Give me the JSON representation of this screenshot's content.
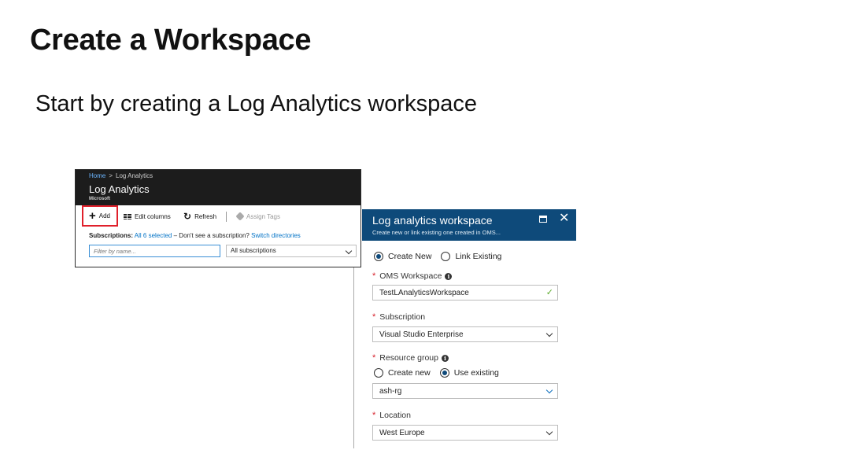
{
  "slide": {
    "title": "Create a Workspace",
    "subtitle": "Start by creating a Log Analytics workspace"
  },
  "log_analytics_blade": {
    "breadcrumb": {
      "home": "Home",
      "separator": ">",
      "current": "Log Analytics"
    },
    "title": "Log Analytics",
    "publisher": "Microsoft",
    "toolbar": {
      "add_label": "Add",
      "edit_columns_label": "Edit columns",
      "refresh_label": "Refresh",
      "assign_tags_label": "Assign Tags"
    },
    "subscriptions": {
      "label": "Subscriptions:",
      "selected_link": "All 6 selected",
      "prompt": "– Don't see a subscription?",
      "switch_link": "Switch directories"
    },
    "filter": {
      "placeholder": "Filter by name..."
    },
    "subscription_select": {
      "value": "All subscriptions"
    },
    "colors": {
      "header_bg": "#1c1c1c",
      "link": "#0072c6",
      "highlight": "#e0202b"
    },
    "icons": {
      "add": "plus-icon",
      "edit_columns": "grid-icon",
      "refresh": "refresh-icon",
      "assign_tags": "tag-icon"
    }
  },
  "workspace_blade": {
    "title": "Log analytics workspace",
    "subtitle": "Create new or link existing one created in OMS...",
    "header_color": "#0e4a7a",
    "mode": {
      "create_new_label": "Create New",
      "link_existing_label": "Link Existing",
      "selected": "Create New"
    },
    "oms_workspace": {
      "label": "OMS Workspace",
      "value": "TestLAnalyticsWorkspace",
      "valid": true
    },
    "subscription": {
      "label": "Subscription",
      "value": "Visual Studio Enterprise"
    },
    "resource_group": {
      "label": "Resource group",
      "create_new_label": "Create new",
      "use_existing_label": "Use existing",
      "selected": "Use existing",
      "value": "ash-rg"
    },
    "location": {
      "label": "Location",
      "value": "West Europe"
    },
    "required_marker": "*",
    "info_glyph": "i",
    "icons": {
      "maximize": "maximize-icon",
      "close": "close-icon",
      "info": "info-icon",
      "valid": "check-icon",
      "dropdown": "chevron-down-icon"
    }
  }
}
